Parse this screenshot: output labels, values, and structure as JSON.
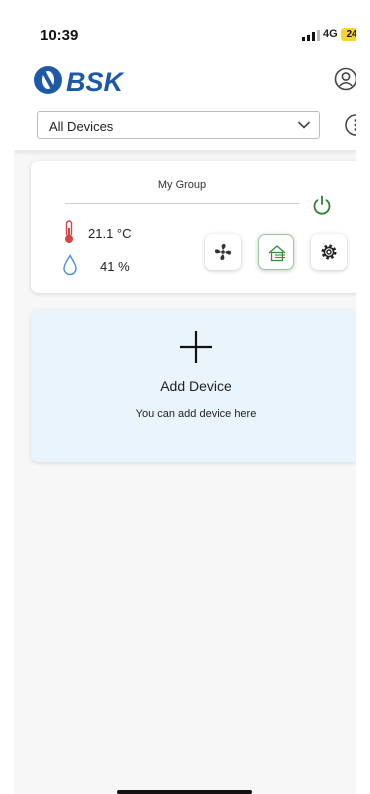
{
  "status_bar": {
    "time": "10:39",
    "network": "4G",
    "battery": "24"
  },
  "header": {
    "logo_text": "BSK",
    "brand_color": "#1e59a8",
    "device_filter": {
      "selected": "All Devices"
    }
  },
  "group": {
    "title": "My Group",
    "temperature": "21.1 °C",
    "humidity": "41 %",
    "power_color": "#2e7d32",
    "modes": [
      "fan-icon",
      "home-vent-icon",
      "gear-icon"
    ]
  },
  "add_device": {
    "title": "Add Device",
    "subtitle": "You can add device here"
  }
}
